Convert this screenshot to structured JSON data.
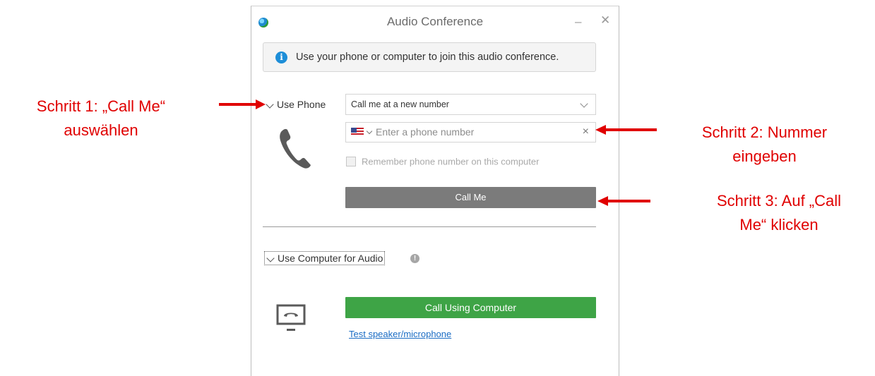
{
  "window": {
    "title": "Audio Conference",
    "minimize_label": "–",
    "close_label": "✕"
  },
  "info_banner": {
    "text": "Use your phone or computer to join this audio conference."
  },
  "phone_section": {
    "toggle_label": "Use Phone",
    "select_value": "Call me at a new number",
    "phone_placeholder": "Enter a phone number",
    "country_flag": "us-flag-icon",
    "clear_label": "×",
    "remember_label": "Remember phone number on this computer",
    "call_button_label": "Call Me",
    "call_button_color": "#7b7b7b"
  },
  "computer_section": {
    "toggle_label": "Use Computer for Audio",
    "call_button_label": "Call Using Computer",
    "call_button_color": "#3ea446",
    "test_link_label": "Test speaker/microphone"
  },
  "annotations": {
    "step1": "Schritt 1: „Call Me“ auswählen",
    "step2": "Schritt 2: Nummer eingeben",
    "step3": "Schritt 3: Auf „Call Me“ klicken",
    "color": "#e00000"
  }
}
